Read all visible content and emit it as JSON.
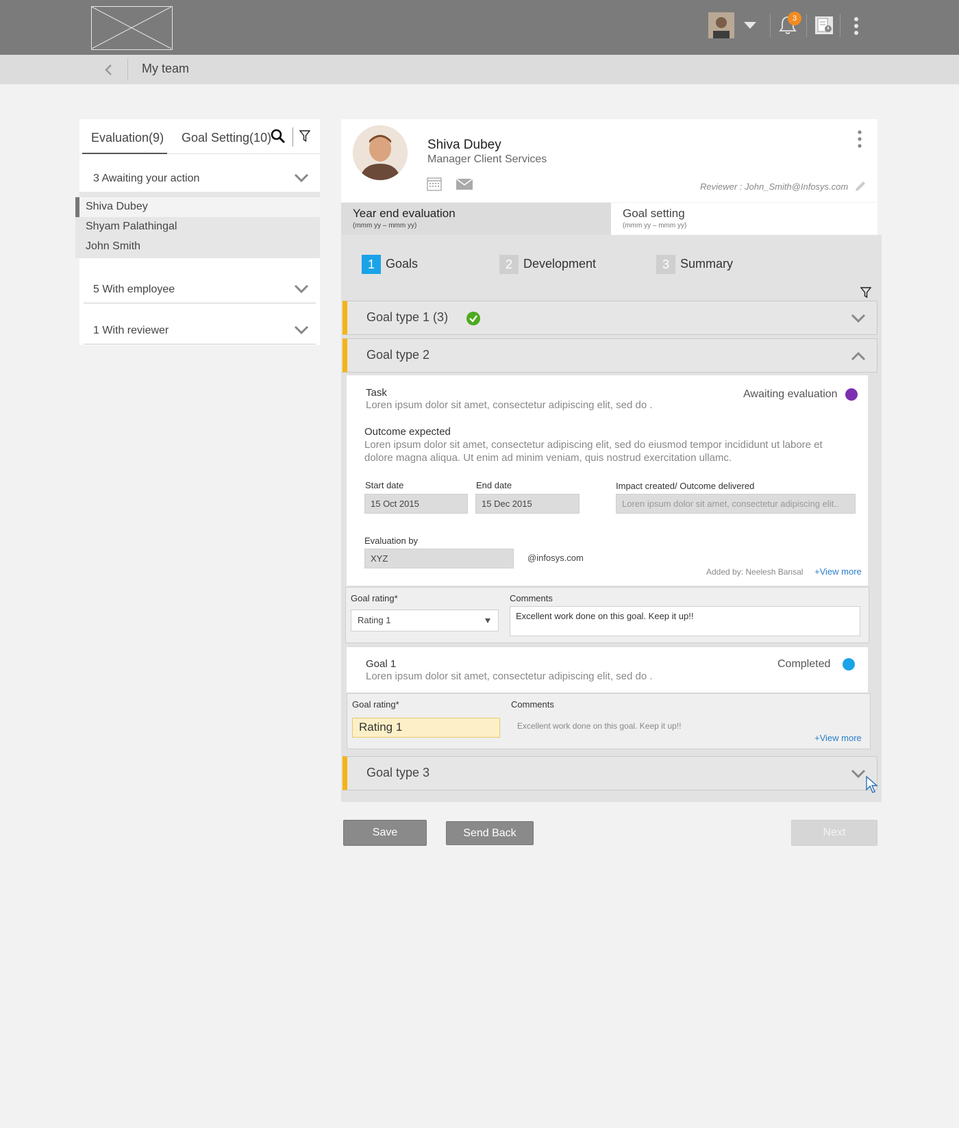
{
  "header": {
    "notification_count": "3",
    "colors": {
      "topbar": "#7b7b7b",
      "badge": "#f28b22"
    }
  },
  "breadcrumb": {
    "title": "My team"
  },
  "left_panel": {
    "tabs": [
      {
        "label": "Evaluation(9)",
        "active": true
      },
      {
        "label": "Goal Setting(10)",
        "active": false
      }
    ],
    "groups": [
      {
        "label": "3  Awaiting your action",
        "expanded": true,
        "people": [
          "Shiva Dubey",
          "Shyam Palathingal",
          "John Smith"
        ]
      },
      {
        "label": "5  With employee",
        "expanded": false
      },
      {
        "label": "1  With reviewer",
        "expanded": false
      }
    ],
    "selected_person": "Shiva Dubey"
  },
  "profile": {
    "name": "Shiva Dubey",
    "role": "Manager Client Services",
    "reviewer": "Reviewer : John_Smith@Infosys.com"
  },
  "eval_tabs": [
    {
      "title": "Year end evaluation",
      "sub": "(mmm yy – mmm yy)",
      "active": true
    },
    {
      "title": "Goal setting",
      "sub": "(mmm yy – mmm yy)",
      "active": false
    }
  ],
  "steps": [
    {
      "num": "1",
      "label": "Goals",
      "active": true
    },
    {
      "num": "2",
      "label": "Development",
      "active": false
    },
    {
      "num": "3",
      "label": "Summary",
      "active": false
    }
  ],
  "goal_types": [
    {
      "label": "Goal type 1 (3)",
      "complete": true,
      "expanded": false
    },
    {
      "label": "Goal type 2",
      "expanded": true
    },
    {
      "label": "Goal type 3",
      "expanded": false
    }
  ],
  "task": {
    "title": "Task",
    "text": "Loren ipsum dolor sit amet, consectetur adipiscing elit, sed do .",
    "status": "Awaiting evaluation",
    "status_color": "#7b2fb0",
    "outcome_label": "Outcome expected",
    "outcome_text_1": "Loren ipsum dolor sit amet, consectetur adipiscing elit, sed do eiusmod tempor incididunt ut labore et",
    "outcome_text_2": "dolore magna aliqua. Ut enim ad minim veniam, quis nostrud exercitation ullamc.",
    "start_label": "Start date",
    "start_value": "15 Oct 2015",
    "end_label": "End date",
    "end_value": "15 Dec 2015",
    "impact_label": "Impact created/ Outcome delivered",
    "impact_placeholder": "Loren ipsum dolor sit amet, consectetur adipiscing elit..",
    "eval_by_label": "Evaluation by",
    "eval_by_value": "XYZ",
    "domain": "@infosys.com",
    "added_by": "Added by: Neelesh Bansal",
    "view_more": "+View more",
    "rating_label": "Goal rating*",
    "rating_value": "Rating 1",
    "comments_label": "Comments",
    "comments_value": "Excellent work done on this goal. Keep it up!!"
  },
  "goal1": {
    "title": "Goal 1",
    "text": "Loren ipsum dolor sit amet, consectetur adipiscing elit, sed do .",
    "status": "Completed",
    "status_color": "#1aa3e8",
    "rating_label": "Goal rating*",
    "rating_value": "Rating 1",
    "comments_label": "Comments",
    "comments_value": "Excellent work done on this goal. Keep it up!!",
    "view_more": "+View more"
  },
  "actions": {
    "save": "Save",
    "send_back": "Send Back",
    "next": "Next"
  }
}
